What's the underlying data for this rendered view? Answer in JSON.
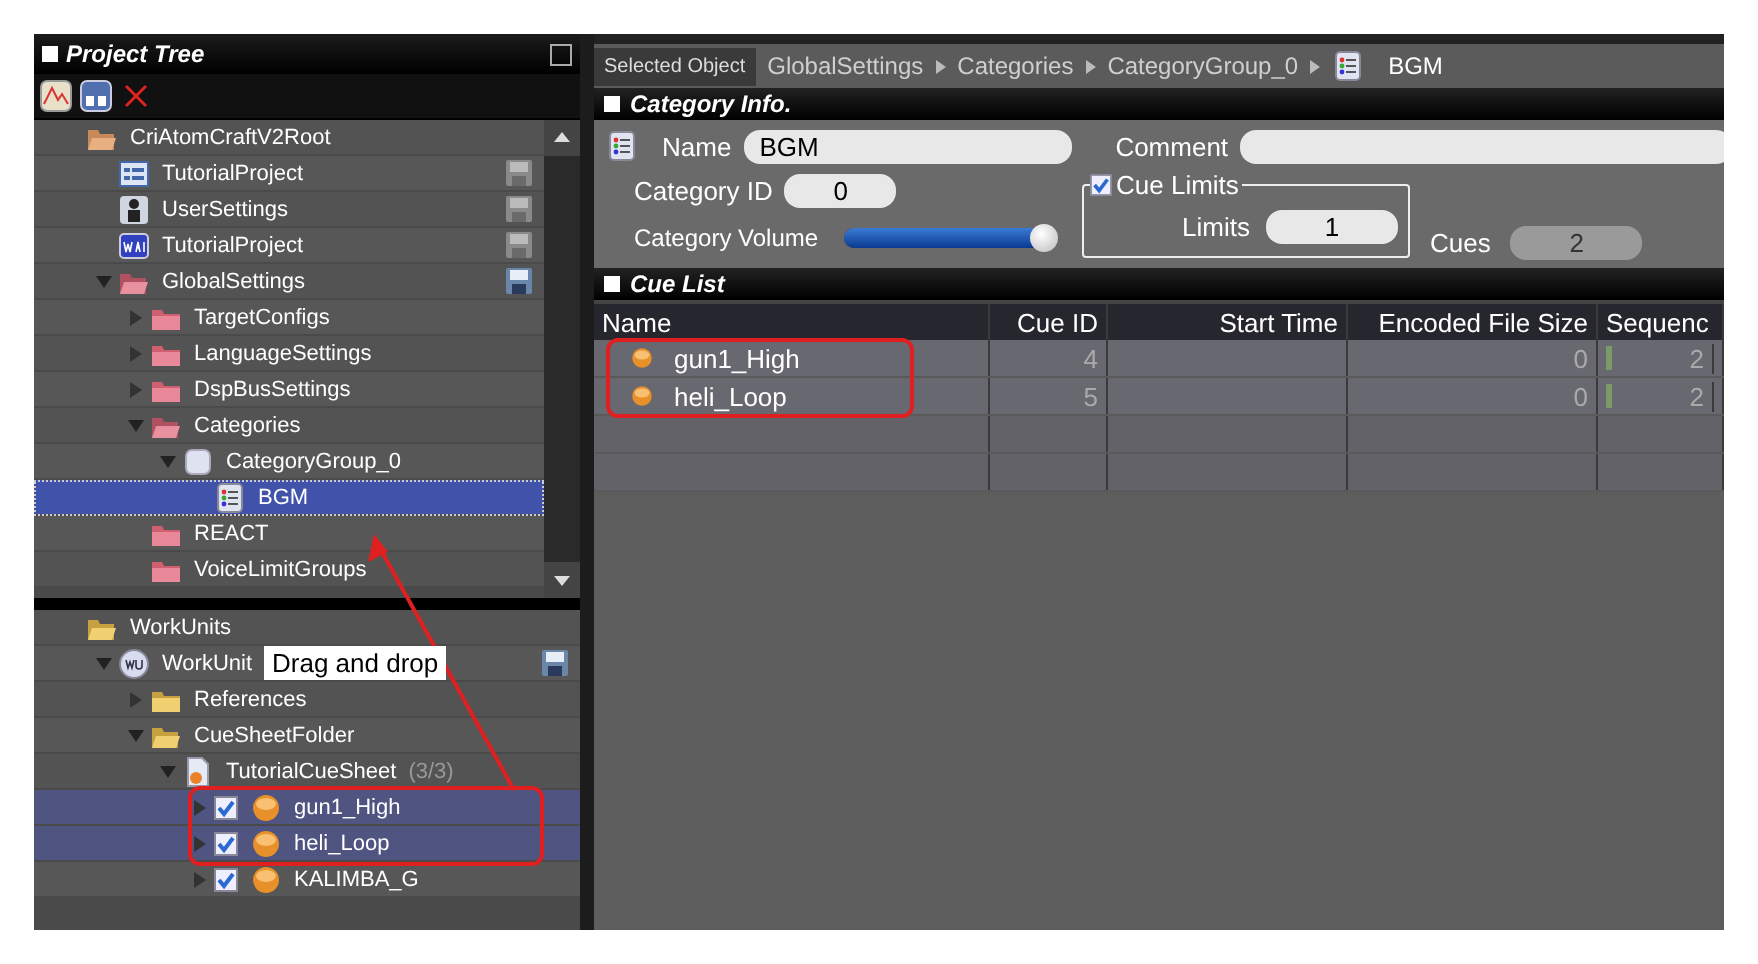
{
  "project_tree": {
    "title": "Project Tree",
    "upper_tree": [
      {
        "label": "CriAtomCraftV2Root",
        "kind": "folder-open",
        "selected": false,
        "children": [
          {
            "label": "TutorialProject",
            "kind": "project",
            "selected": false,
            "save": false
          },
          {
            "label": "UserSettings",
            "kind": "user",
            "selected": false,
            "save": false
          },
          {
            "label": "TutorialProject",
            "kind": "wav",
            "selected": false,
            "save": false
          },
          {
            "label": "GlobalSettings",
            "kind": "folder-red-open",
            "expanded": true,
            "selected": false,
            "save": true,
            "children": [
              {
                "label": "TargetConfigs",
                "kind": "folder-red",
                "expanded": false,
                "selected": false
              },
              {
                "label": "LanguageSettings",
                "kind": "folder-red",
                "expanded": false,
                "selected": false
              },
              {
                "label": "DspBusSettings",
                "kind": "folder-red",
                "expanded": false,
                "selected": false
              },
              {
                "label": "Categories",
                "kind": "folder-red-open",
                "expanded": true,
                "selected": false,
                "children": [
                  {
                    "label": "CategoryGroup_0",
                    "kind": "category-group",
                    "expanded": true,
                    "selected": false,
                    "children": [
                      {
                        "label": "BGM",
                        "kind": "category",
                        "selected": true
                      }
                    ]
                  }
                ]
              },
              {
                "label": "REACT",
                "kind": "folder-red",
                "selected": false
              },
              {
                "label": "VoiceLimitGroups",
                "kind": "folder-red",
                "selected": false
              }
            ]
          }
        ]
      }
    ],
    "lower_tree": [
      {
        "label": "WorkUnits",
        "kind": "folder-yellow-open",
        "selected": false,
        "children": [
          {
            "label": "WorkUnit",
            "kind": "workunit",
            "expanded": true,
            "selected": false,
            "save": true,
            "children": [
              {
                "label": "References",
                "kind": "folder-yellow",
                "expanded": false,
                "selected": false
              },
              {
                "label": "CueSheetFolder",
                "kind": "folder-yellow-open",
                "expanded": true,
                "selected": false,
                "children": [
                  {
                    "label": "TutorialCueSheet",
                    "count": "(3/3)",
                    "kind": "cuesheet",
                    "expanded": true,
                    "selected": false,
                    "children": [
                      {
                        "label": "gun1_High",
                        "kind": "cue",
                        "expanded": false,
                        "checked": true,
                        "selected": true
                      },
                      {
                        "label": "heli_Loop",
                        "kind": "cue",
                        "expanded": false,
                        "checked": true,
                        "selected": true
                      },
                      {
                        "label": "KALIMBA_G",
                        "kind": "cue",
                        "expanded": false,
                        "checked": true,
                        "selected": false
                      }
                    ]
                  }
                ]
              }
            ]
          }
        ]
      }
    ]
  },
  "breadcrumb": {
    "label": "Selected Object",
    "path": [
      "GlobalSettings",
      "Categories",
      "CategoryGroup_0"
    ],
    "current": "BGM"
  },
  "category_info": {
    "title": "Category Info.",
    "name_label": "Name",
    "name": "BGM",
    "comment_label": "Comment",
    "category_id_label": "Category ID",
    "category_id": "0",
    "volume_label": "Category Volume",
    "volume": {
      "level": 1
    },
    "cue_limits": {
      "label": "Cue Limits",
      "checked": true,
      "limits_label": "Limits",
      "limits": "1"
    },
    "cues_label": "Cues",
    "cues": "2"
  },
  "cue_list": {
    "title": "Cue List",
    "columns": [
      "Name",
      "Cue ID",
      "Start Time",
      "Encoded File Size",
      "Sequenc"
    ],
    "rows": [
      {
        "name": "gun1_High",
        "cue_id": "4",
        "encoded_file_size": "0",
        "sequence": "2"
      },
      {
        "name": "heli_Loop",
        "cue_id": "5",
        "encoded_file_size": "0",
        "sequence": "2"
      }
    ]
  },
  "annotation": {
    "tooltip": "Drag and drop"
  }
}
